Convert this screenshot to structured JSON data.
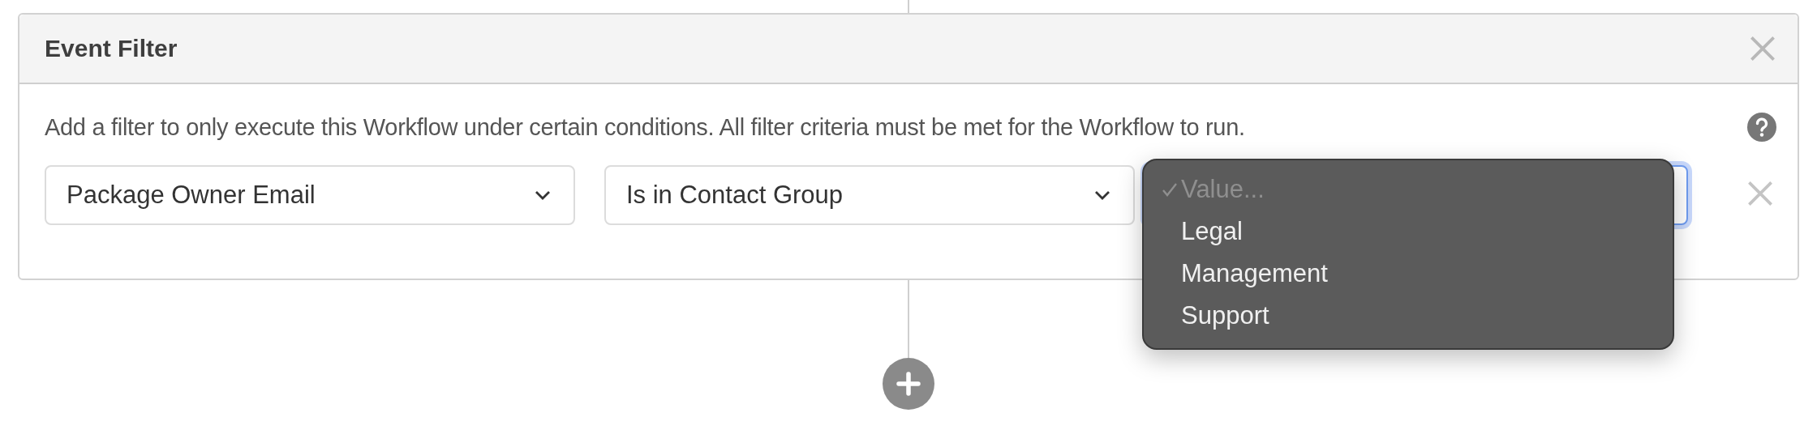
{
  "panel": {
    "title": "Event Filter",
    "description": "Add a filter to only execute this Workflow under certain conditions. All filter criteria must be met for the Workflow to run."
  },
  "filter_row": {
    "field": "Package Owner Email",
    "operator": "Is in Contact Group",
    "value_focused": true
  },
  "value_menu": [
    {
      "label": "Value...",
      "selected": true
    },
    {
      "label": "Legal",
      "selected": false
    },
    {
      "label": "Management",
      "selected": false
    },
    {
      "label": "Support",
      "selected": false
    }
  ]
}
